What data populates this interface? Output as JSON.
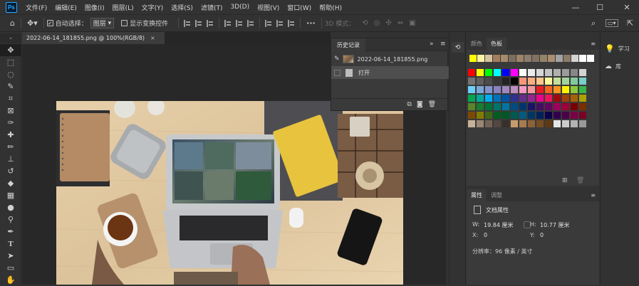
{
  "app": {
    "logo": "Ps"
  },
  "menu": [
    "文件(F)",
    "编辑(E)",
    "图像(I)",
    "图层(L)",
    "文字(Y)",
    "选择(S)",
    "滤镜(T)",
    "3D(D)",
    "视图(V)",
    "窗口(W)",
    "帮助(H)"
  ],
  "window_controls": {
    "minimize": "—",
    "maximize": "☐",
    "close": "✕"
  },
  "options_bar": {
    "auto_select_label": "自动选择：",
    "auto_select_checked": true,
    "auto_select_value": "图层",
    "show_transform_label": "显示变换控件",
    "mode_3d_label": "3D 模式：",
    "more_label": "···"
  },
  "document": {
    "tab_label": "2022-06-14_181855.png @ 100%(RGB/8)",
    "close_glyph": "×"
  },
  "history_panel": {
    "title": "历史记录",
    "collapse_glyph": "»",
    "menu_glyph": "≡",
    "snapshot_label": "2022-06-14_181855.png",
    "steps": [
      "打开"
    ]
  },
  "swatches_panel": {
    "tabs": [
      "颜色",
      "色板"
    ],
    "active_tab": "色板",
    "recent_colors": [
      "#ffff00",
      "#fcf2a6",
      "#d5c59f",
      "#a37e5d",
      "#a58a6c",
      "#7b6f5b",
      "#9d8468",
      "#8c7e6c",
      "#827163",
      "#948467",
      "#a98e71",
      "#a3a3a3",
      "#8c7b68",
      "#d4d4d4",
      "#ffffff",
      "#ffffff"
    ],
    "grid_colors": [
      [
        "#ff0000",
        "#ffff00",
        "#00ff00",
        "#00ffff",
        "#0000ff",
        "#ff00ff",
        "#ffffff",
        "#ebebeb",
        "#d7d7d7",
        "#c3c3c3",
        "#afafaf",
        "#9b9b9b",
        "#878787",
        "#d3d3d3"
      ],
      [
        "#737373",
        "#5f5f5f",
        "#4b4b4b",
        "#373737",
        "#232323",
        "#000000",
        "#f7977a",
        "#f9ad81",
        "#fdc68a",
        "#fff79a",
        "#c4df9b",
        "#a3d39c",
        "#82ca9d",
        "#7bcdc8"
      ],
      [
        "#6ecff6",
        "#7ea7d8",
        "#8493ca",
        "#8882be",
        "#a187be",
        "#bc8dbf",
        "#f49ac2",
        "#f6989d",
        "#ed1c24",
        "#f26522",
        "#f7941d",
        "#fff200",
        "#8dc63f",
        "#39b54a"
      ],
      [
        "#00a651",
        "#00a99d",
        "#00aeef",
        "#0072bc",
        "#0054a6",
        "#2e3192",
        "#662d91",
        "#92278f",
        "#ec008c",
        "#ed145b",
        "#9e0b0f",
        "#a0410d",
        "#a36209",
        "#aba000"
      ],
      [
        "#598527",
        "#1a7b30",
        "#007236",
        "#00746b",
        "#0076a3",
        "#004b80",
        "#003471",
        "#1b1464",
        "#440e62",
        "#630460",
        "#9e005d",
        "#9e0039",
        "#790000",
        "#7b2e00"
      ],
      [
        "#7d4900",
        "#827b00",
        "#406618",
        "#005e20",
        "#005826",
        "#005952",
        "#005b7f",
        "#003663",
        "#002157",
        "#0d004c",
        "#32004b",
        "#4b0049",
        "#7b0046",
        "#7a0026"
      ],
      [
        "#c7b299",
        "#998675",
        "#736357",
        "#534741",
        "#37302a",
        "#c69c6d",
        "#a67c52",
        "#8c6239",
        "#754c24",
        "#603913",
        "#e6e6e6",
        "#cccccc",
        "#b3b3b3",
        "#999999"
      ]
    ]
  },
  "properties_panel": {
    "tabs": [
      "属性",
      "调整"
    ],
    "active_tab": "属性",
    "section": "文档属性",
    "w_label": "W:",
    "w_value": "19.84 厘米",
    "h_label": "H:",
    "h_value": "10.77 厘米",
    "x_label": "X:",
    "x_value": "0",
    "y_label": "Y:",
    "y_value": "0",
    "resolution": "分辨率：96 像素 / 英寸"
  },
  "learn_panel": {
    "learn_label": "学习",
    "library_label": "库"
  }
}
